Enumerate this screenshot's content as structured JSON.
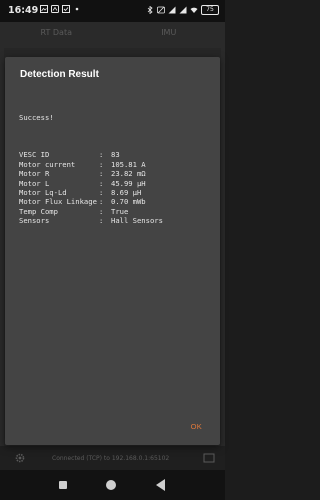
{
  "status_bar": {
    "time": "16:49",
    "battery": "75"
  },
  "app_background": {
    "tabs": [
      "RT Data",
      "IMU"
    ],
    "bottom_text": "Connected (TCP) to 192.168.0.1:65102"
  },
  "dialog": {
    "title": "Detection Result",
    "success": "Success!",
    "rows": [
      {
        "key": "VESC ID",
        "value": "83"
      },
      {
        "key": "Motor current",
        "value": "105.81 A"
      },
      {
        "key": "Motor R",
        "value": "23.82 mΩ"
      },
      {
        "key": "Motor L",
        "value": "45.99 µH"
      },
      {
        "key": "Motor Lq-Ld",
        "value": "8.69 µH"
      },
      {
        "key": "Motor Flux Linkage",
        "value": "0.70 mWb"
      },
      {
        "key": "Temp Comp",
        "value": "True"
      },
      {
        "key": "Sensors",
        "value": "Hall Sensors"
      }
    ],
    "ok_label": "OK"
  },
  "colors": {
    "dialog_bg": "#444444",
    "accent": "#e0783a"
  }
}
